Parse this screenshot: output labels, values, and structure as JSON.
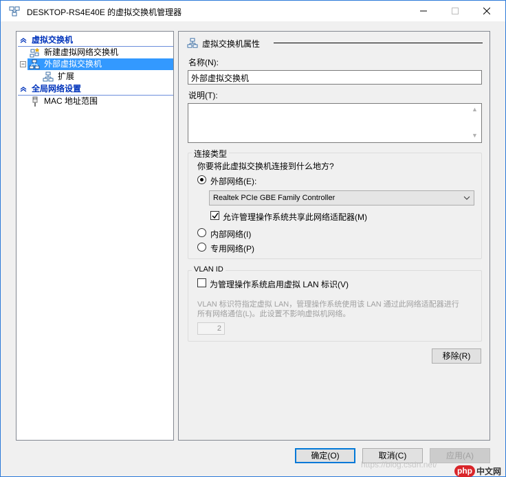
{
  "window": {
    "title": "DESKTOP-RS4E40E 的虚拟交换机管理器",
    "icon": "virtual-switch-manager-icon"
  },
  "tree": {
    "section1": "虚拟交换机",
    "new_switch": "新建虚拟网络交换机",
    "external_switch": "外部虚拟交换机",
    "extensions": "扩展",
    "section2": "全局网络设置",
    "mac_range": "MAC 地址范围"
  },
  "properties": {
    "header": "虚拟交换机属性",
    "name_label": "名称(N):",
    "name_value": "外部虚拟交换机",
    "notes_label": "说明(T):",
    "notes_value": "",
    "connection_type": {
      "title": "连接类型",
      "question": "你要将此虚拟交换机连接到什么地方?",
      "external_label": "外部网络(E):",
      "external_selected": true,
      "adapter": "Realtek PCIe GBE Family Controller",
      "allow_share_label": "允许管理操作系统共享此网络适配器(M)",
      "allow_share_checked": true,
      "internal_label": "内部网络(I)",
      "private_label": "专用网络(P)"
    },
    "vlan": {
      "title": "VLAN ID",
      "enable_label": "为管理操作系统启用虚拟 LAN 标识(V)",
      "enable_checked": false,
      "desc_line1": "VLAN 标识符指定虚拟 LAN，管理操作系统使用该 LAN 通过此网络适配器进行",
      "desc_line2": "所有网络通信(L)。此设置不影响虚拟机网络。",
      "id_value": "2"
    },
    "remove_button": "移除(R)"
  },
  "footer": {
    "ok": "确定(O)",
    "cancel": "取消(C)",
    "apply": "应用(A)"
  },
  "watermark": {
    "url": "https://blog.csdn.net/",
    "logo_text": "php",
    "site": "中文网"
  },
  "colors": {
    "selection": "#3399ff",
    "section_blue": "#0033bb",
    "default_button_border": "#0078d7"
  }
}
